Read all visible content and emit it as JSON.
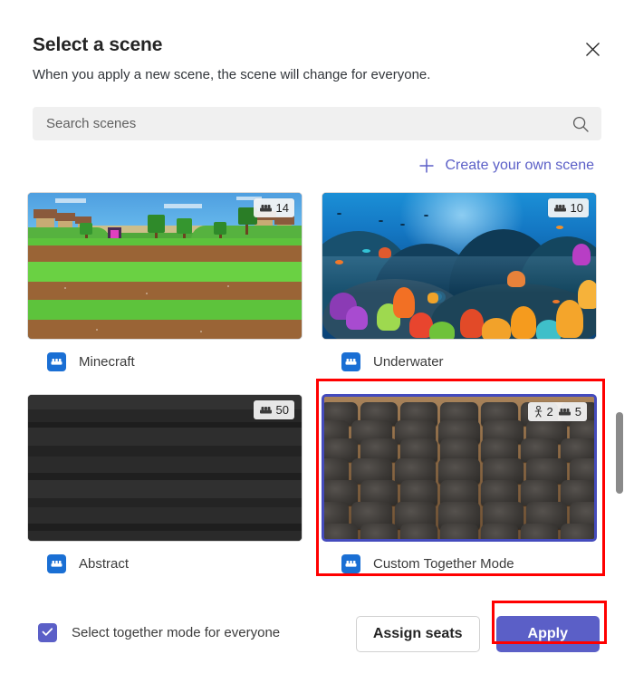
{
  "dialog": {
    "title": "Select a scene",
    "subtitle": "When you apply a new scene, the scene will change for everyone.",
    "close_icon": "close-icon"
  },
  "search": {
    "placeholder": "Search scenes",
    "value": "",
    "icon": "search-icon"
  },
  "create_scene": {
    "label": "Create your own scene",
    "icon": "plus-icon",
    "color": "#5b5fc7"
  },
  "scenes": [
    {
      "name": "Minecraft",
      "art": "minecraft",
      "selected": false,
      "badge": {
        "seats": "14",
        "standing": null,
        "seats_icon": "seats-icon"
      }
    },
    {
      "name": "Underwater",
      "art": "underwater",
      "selected": false,
      "badge": {
        "seats": "10",
        "standing": null,
        "seats_icon": "seats-icon"
      }
    },
    {
      "name": "Abstract",
      "art": "abstract",
      "selected": false,
      "badge": {
        "seats": "50",
        "standing": null,
        "seats_icon": "seats-icon"
      }
    },
    {
      "name": "Custom Together Mode",
      "art": "together",
      "selected": true,
      "badge": {
        "seats": "5",
        "standing": "2",
        "seats_icon": "seats-icon",
        "standing_icon": "standing-person-icon"
      }
    }
  ],
  "footer": {
    "checkbox": {
      "label": "Select together mode for everyone",
      "checked": true,
      "color": "#5b5fc7"
    },
    "assign_seats_label": "Assign seats",
    "apply_label": "Apply",
    "apply_color": "#5b5fc7"
  },
  "scrollbar": {
    "name": "vertical-scrollbar"
  },
  "annotations": {
    "color": "#ff0000"
  }
}
